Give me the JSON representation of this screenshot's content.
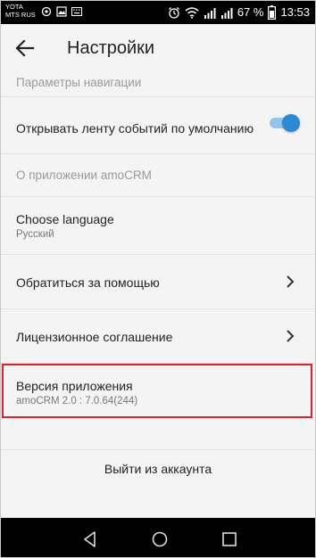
{
  "status_bar": {
    "carrier_1": "YOTA",
    "carrier_2": "MTS RUS",
    "battery": "67 %",
    "time": "13:53"
  },
  "app_bar": {
    "title": "Настройки"
  },
  "settings": {
    "navigation_section": "Параметры навигации",
    "open_feed_label": "Открывать ленту событий по умолчанию",
    "open_feed_enabled": true,
    "about_section": "О приложении amoCRM",
    "language": {
      "title": "Choose language",
      "value": "Русский"
    },
    "help": {
      "title": "Обратиться за помощью"
    },
    "license": {
      "title": "Лицензионное соглашение"
    },
    "version": {
      "title": "Версия приложения",
      "value": "amoCRM 2.0 : 7.0.64(244)"
    },
    "logout_label": "Выйти из аккаунта"
  },
  "colors": {
    "toggle_accent": "#2a8ad6",
    "highlight": "#e0202a"
  },
  "icons": {
    "back": "back-arrow-icon",
    "chevron": "chevron-right-icon",
    "nav_back": "nav-back-icon",
    "nav_home": "nav-home-icon",
    "nav_recents": "nav-recents-icon"
  }
}
